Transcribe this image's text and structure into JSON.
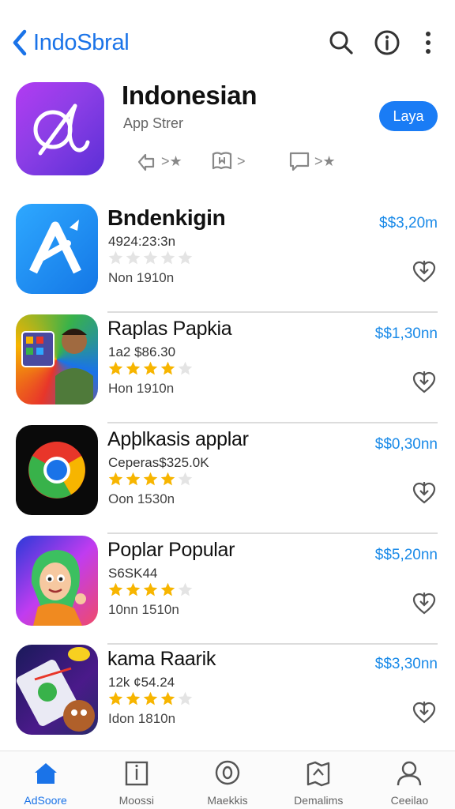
{
  "nav": {
    "back_label": "IndoSbral"
  },
  "hero": {
    "title": "Indonesian",
    "subtitle": "App Strer",
    "get_label": "Laya",
    "actions": [
      {
        "icon": "share-icon",
        "label": ">★"
      },
      {
        "icon": "bookmark-icon",
        "label": ">"
      },
      {
        "icon": "comment-icon",
        "label": ">★"
      }
    ]
  },
  "apps": [
    {
      "name": "Bndenkigin",
      "meta": "4924:23:3n",
      "rating": 0,
      "size": "Non 1910n",
      "price": "$$3,20m",
      "icon": "a-logo-icon"
    },
    {
      "name": "Raplas Papkia",
      "meta": "1a2 $86.30",
      "rating": 4,
      "size": "Hon 1910n",
      "price": "$$1,30nn",
      "icon": "person-game-icon"
    },
    {
      "name": "Apþlkasis applar",
      "meta": "Ceperas$325.0K",
      "rating": 4,
      "size": "Oon 1530n",
      "price": "$$0,30nn",
      "icon": "chrome-logo-icon"
    },
    {
      "name": "Poplar Popular",
      "meta": "S6SK44",
      "rating": 4,
      "size": "10nn 1510n",
      "price": "$$5,20nn",
      "icon": "cartoon-character-icon"
    },
    {
      "name": "kama Raarik",
      "meta": "12k ¢54.24",
      "rating": 4,
      "size": "Idon 1810n",
      "price": "$$3,30nn",
      "icon": "phone-game-icon"
    }
  ],
  "tabs": [
    {
      "label": "AdSoore",
      "icon": "home-icon",
      "active": true
    },
    {
      "label": "Moossi",
      "icon": "document-icon",
      "active": false
    },
    {
      "label": "Maekkis",
      "icon": "badge-icon",
      "active": false
    },
    {
      "label": "Demalims",
      "icon": "map-icon",
      "active": false
    },
    {
      "label": "Ceeilao",
      "icon": "person-icon",
      "active": false
    }
  ],
  "colors": {
    "accent": "#1a73e8",
    "price": "#1a8ae8",
    "star": "#f7b500",
    "hero_gradient": [
      "#b23cf2",
      "#5b2fd6"
    ]
  }
}
